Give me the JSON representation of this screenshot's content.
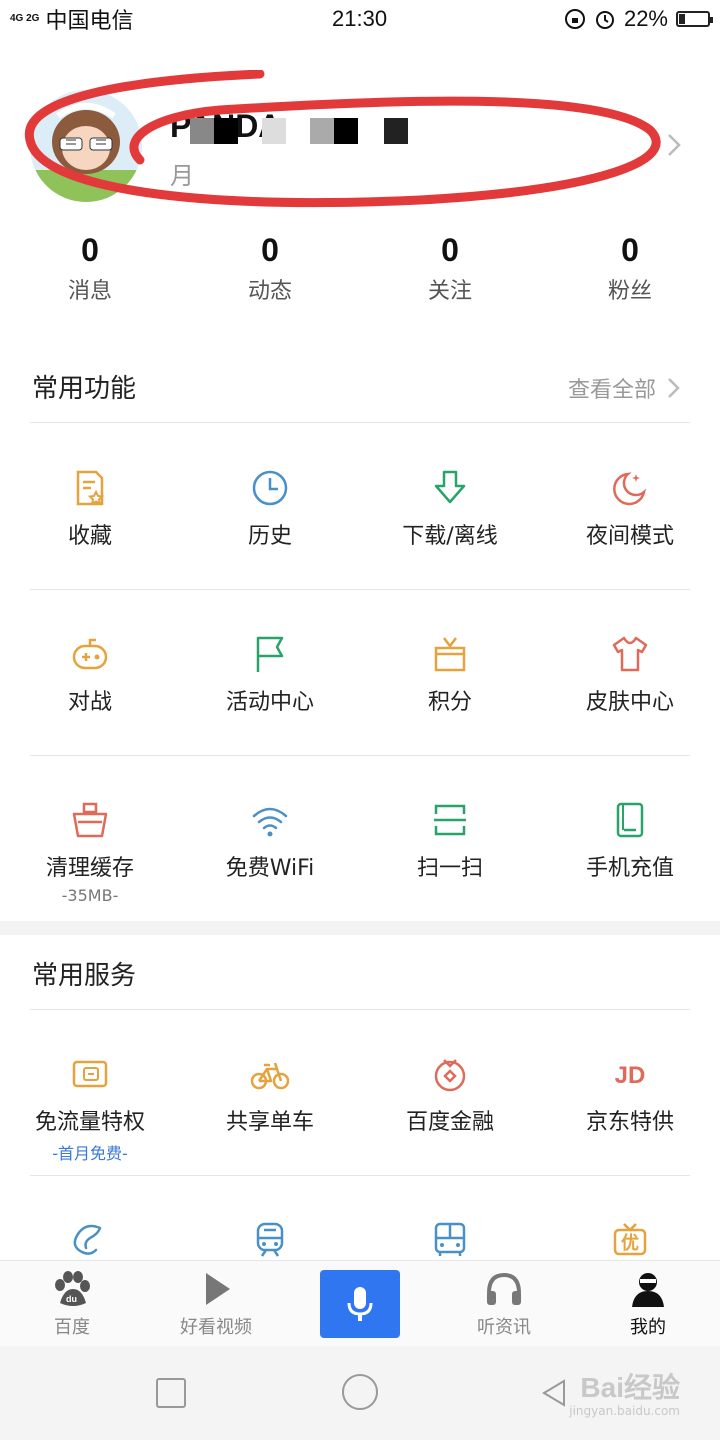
{
  "status_bar": {
    "signal": "4G 2G",
    "carrier": "中国电信",
    "time": "21:30",
    "battery_percent": "22%",
    "battery_level": 0.22
  },
  "profile": {
    "username": "PANDA",
    "subline": "月"
  },
  "stats": [
    {
      "num": "0",
      "label": "消息"
    },
    {
      "num": "0",
      "label": "动态"
    },
    {
      "num": "0",
      "label": "关注"
    },
    {
      "num": "0",
      "label": "粉丝"
    }
  ],
  "common_functions": {
    "title": "常用功能",
    "see_all": "查看全部",
    "rows": [
      [
        {
          "label": "收藏",
          "icon": "favorite-icon",
          "color": "#e6a23c"
        },
        {
          "label": "历史",
          "icon": "clock-icon",
          "color": "#4a90c8"
        },
        {
          "label": "下载/离线",
          "icon": "download-icon",
          "color": "#2aa36b"
        },
        {
          "label": "夜间模式",
          "icon": "moon-icon",
          "color": "#e06a5a"
        }
      ],
      [
        {
          "label": "对战",
          "icon": "gamepad-icon",
          "color": "#e6a23c"
        },
        {
          "label": "活动中心",
          "icon": "flag-icon",
          "color": "#2aa36b"
        },
        {
          "label": "积分",
          "icon": "gift-icon",
          "color": "#e6a23c"
        },
        {
          "label": "皮肤中心",
          "icon": "tshirt-icon",
          "color": "#e06a5a"
        }
      ],
      [
        {
          "label": "清理缓存",
          "sub": "-35MB-",
          "icon": "broom-icon",
          "color": "#e06a5a"
        },
        {
          "label": "免费WiFi",
          "icon": "wifi-icon",
          "color": "#4a90c8"
        },
        {
          "label": "扫一扫",
          "icon": "scan-icon",
          "color": "#2aa36b"
        },
        {
          "label": "手机充值",
          "icon": "phone-recharge-icon",
          "color": "#2aa36b"
        }
      ]
    ]
  },
  "common_services": {
    "title": "常用服务",
    "rows": [
      [
        {
          "label": "免流量特权",
          "sub": "-首月免费-",
          "icon": "sim-card-icon",
          "color": "#e6a23c"
        },
        {
          "label": "共享单车",
          "icon": "bicycle-icon",
          "color": "#e6a23c"
        },
        {
          "label": "百度金融",
          "icon": "finance-icon",
          "color": "#e06a5a"
        },
        {
          "label": "京东特供",
          "icon": "jd-icon",
          "color": "#e06a5a",
          "glyph": "JD"
        }
      ],
      [
        {
          "label": "",
          "icon": "dolphin-icon",
          "color": "#4a90c8"
        },
        {
          "label": "",
          "icon": "train-icon",
          "color": "#4a90c8"
        },
        {
          "label": "",
          "icon": "bus-icon",
          "color": "#4a90c8"
        },
        {
          "label": "",
          "icon": "coupon-icon",
          "color": "#e6a23c",
          "glyph": "优"
        }
      ]
    ]
  },
  "tabbar": [
    {
      "label": "百度",
      "icon": "baidu-paw-icon"
    },
    {
      "label": "好看视频",
      "icon": "play-icon"
    },
    {
      "label": "",
      "icon": "microphone-icon"
    },
    {
      "label": "听资讯",
      "icon": "headphones-icon"
    },
    {
      "label": "我的",
      "icon": "user-icon",
      "active": true
    }
  ],
  "watermark": {
    "text": "Bai经验",
    "sub": "jingyan.baidu.com"
  }
}
